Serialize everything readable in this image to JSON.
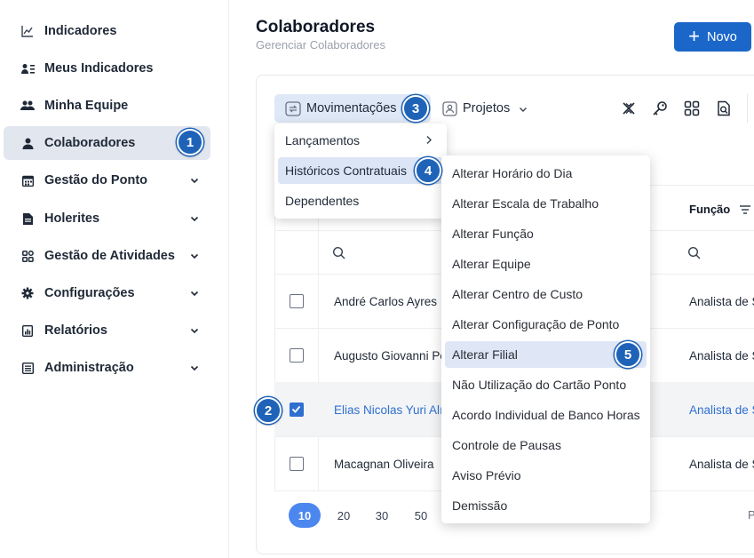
{
  "sidebar": {
    "items": [
      {
        "label": "Indicadores",
        "icon": "chart-line-icon",
        "chevron": false,
        "active": false
      },
      {
        "label": "Meus Indicadores",
        "icon": "user-list-icon",
        "chevron": false,
        "active": false
      },
      {
        "label": "Minha Equipe",
        "icon": "users-icon",
        "chevron": false,
        "active": false
      },
      {
        "label": "Colaboradores",
        "icon": "user-icon",
        "chevron": false,
        "active": true
      },
      {
        "label": "Gestão do Ponto",
        "icon": "calendar-icon",
        "chevron": true,
        "active": false
      },
      {
        "label": "Holerites",
        "icon": "document-icon",
        "chevron": true,
        "active": false
      },
      {
        "label": "Gestão de Atividades",
        "icon": "grid-icon",
        "chevron": true,
        "active": false
      },
      {
        "label": "Configurações",
        "icon": "gear-icon",
        "chevron": true,
        "active": false
      },
      {
        "label": "Relatórios",
        "icon": "report-icon",
        "chevron": true,
        "active": false
      },
      {
        "label": "Administração",
        "icon": "admin-icon",
        "chevron": true,
        "active": false
      }
    ]
  },
  "header": {
    "title": "Colaboradores",
    "subtitle": "Gerenciar Colaboradores",
    "new_button": "Novo"
  },
  "toolbar": {
    "movimentacoes": "Movimentações",
    "projetos": "Projetos",
    "icons": [
      "close-x-icon",
      "key-icon",
      "qr-code-icon",
      "document-search-icon"
    ]
  },
  "table": {
    "column_funcao": "Função",
    "rows": [
      {
        "name": "André Carlos Ayres",
        "funcao": "Analista de S",
        "checked": false
      },
      {
        "name": "Augusto Giovanni Pe",
        "funcao": "Analista de S",
        "checked": false
      },
      {
        "name": "Elias Nicolas Yuri Alı",
        "funcao": "Analista de S",
        "checked": true
      },
      {
        "name": "Macagnan Oliveira",
        "funcao": "Analista de S",
        "checked": false
      }
    ],
    "page_sizes": [
      "10",
      "20",
      "30",
      "50"
    ],
    "page_size_selected": "10",
    "pager_text": "P"
  },
  "menu_movimentacoes": {
    "items": [
      "Lançamentos",
      "Históricos Contratuais",
      "Dependentes"
    ],
    "highlighted": "Históricos Contratuais"
  },
  "menu_historicos": {
    "items": [
      "Alterar Horário do Dia",
      "Alterar Escala de Trabalho",
      "Alterar Função",
      "Alterar Equipe",
      "Alterar Centro de Custo",
      "Alterar Configuração de Ponto",
      "Alterar Filial",
      "Não Utilização do Cartão Ponto",
      "Acordo Individual de Banco Horas",
      "Controle de Pausas",
      "Aviso Prévio",
      "Demissão"
    ],
    "highlighted": "Alterar Filial"
  },
  "badges": [
    "1",
    "2",
    "3",
    "4",
    "5"
  ],
  "colors": {
    "primary": "#1b67c9",
    "badge": "#1e63b8",
    "active_bg": "#e2e6ee",
    "selected_text": "#2e70cf"
  }
}
